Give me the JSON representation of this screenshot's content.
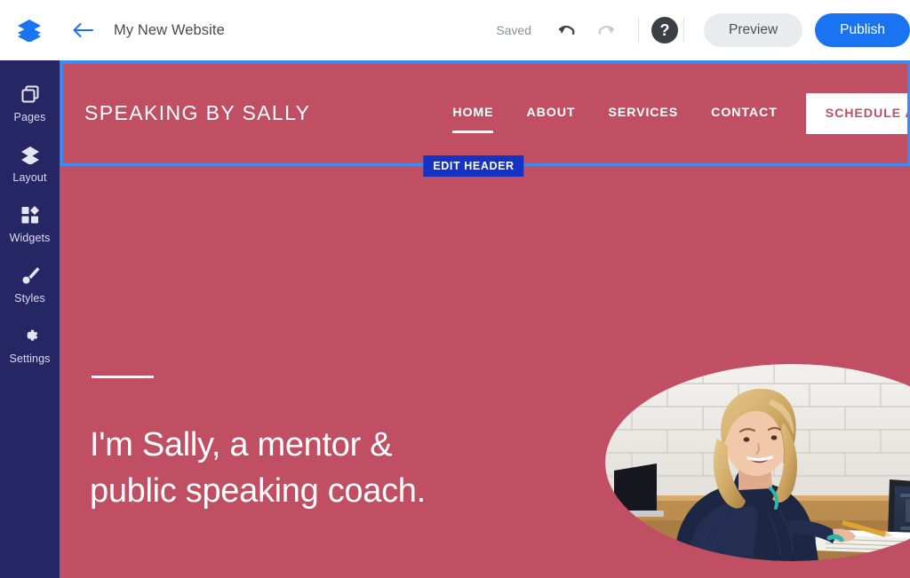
{
  "topbar": {
    "logo_icon": "stacked-layers-logo",
    "back_icon": "back-arrow-icon",
    "site_title": "My New Website",
    "saved_label": "Saved",
    "undo_icon": "undo-icon",
    "redo_icon": "redo-icon",
    "help_icon": "help-question-icon",
    "help_glyph": "?",
    "preview_label": "Preview",
    "publish_label": "Publish"
  },
  "sidebar": {
    "items": [
      {
        "label": "Pages",
        "icon": "pages-icon"
      },
      {
        "label": "Layout",
        "icon": "layout-layers-icon"
      },
      {
        "label": "Widgets",
        "icon": "widgets-grid-icon"
      },
      {
        "label": "Styles",
        "icon": "styles-brush-icon"
      },
      {
        "label": "Settings",
        "icon": "settings-gear-icon"
      }
    ]
  },
  "canvas": {
    "selection_badge": "EDIT HEADER",
    "site_header": {
      "logo_text": "SPEAKING BY SALLY",
      "nav": [
        {
          "label": "HOME",
          "active": true
        },
        {
          "label": "ABOUT",
          "active": false
        },
        {
          "label": "SERVICES",
          "active": false
        },
        {
          "label": "CONTACT",
          "active": false
        }
      ],
      "cta_label": "SCHEDULE A SESSION"
    },
    "hero": {
      "heading_line1": "I'm Sally, a mentor &",
      "heading_line2": "public speaking coach.",
      "photo_alt": "woman-on-phone-at-desk-photo"
    }
  },
  "colors": {
    "sidebar_navy": "#262665",
    "canvas_rose": "#c04f63",
    "selection_blue": "#3b8bf2",
    "badge_blue": "#1433c4",
    "publish_blue": "#1a73f0",
    "preview_gray": "#e9ebee",
    "brand_blue": "#1a73f0"
  }
}
